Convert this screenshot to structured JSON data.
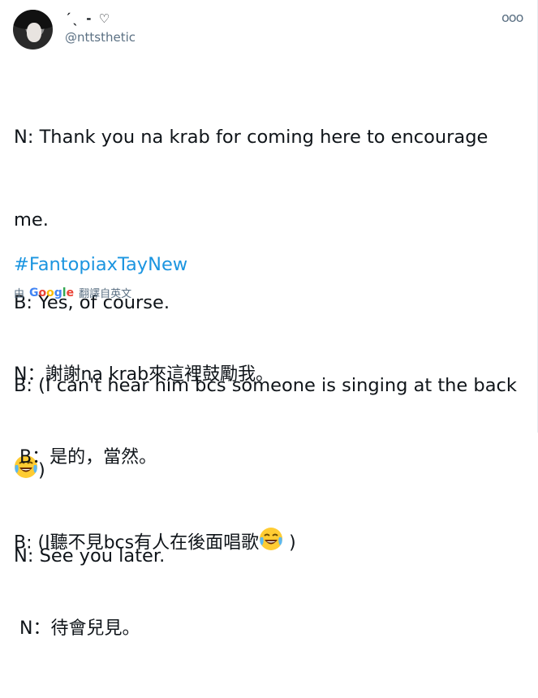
{
  "tweet": {
    "display_name": "ˊˎ - ♡",
    "handle": "@nttsthetic",
    "more_icon": "ooo",
    "lines": [
      "N: Thank you na krab for coming here to encourage",
      "me.",
      "B: Yes, of course.",
      "B: (I can't hear him bcs someone is singing at the back",
      ")",
      "N: See you later."
    ],
    "hashtag": "#FantopiaxTayNew",
    "translation": {
      "prefix": "由",
      "provider": "Google",
      "label": "翻譯自",
      "language": "英文",
      "lines": [
        "N：謝謝na krab來這裡鼓勵我。",
        " B：是的，當然。",
        "B: (I聽不見bcs有人在後面唱歌",
        " )",
        " N：待會兒見。"
      ]
    }
  }
}
